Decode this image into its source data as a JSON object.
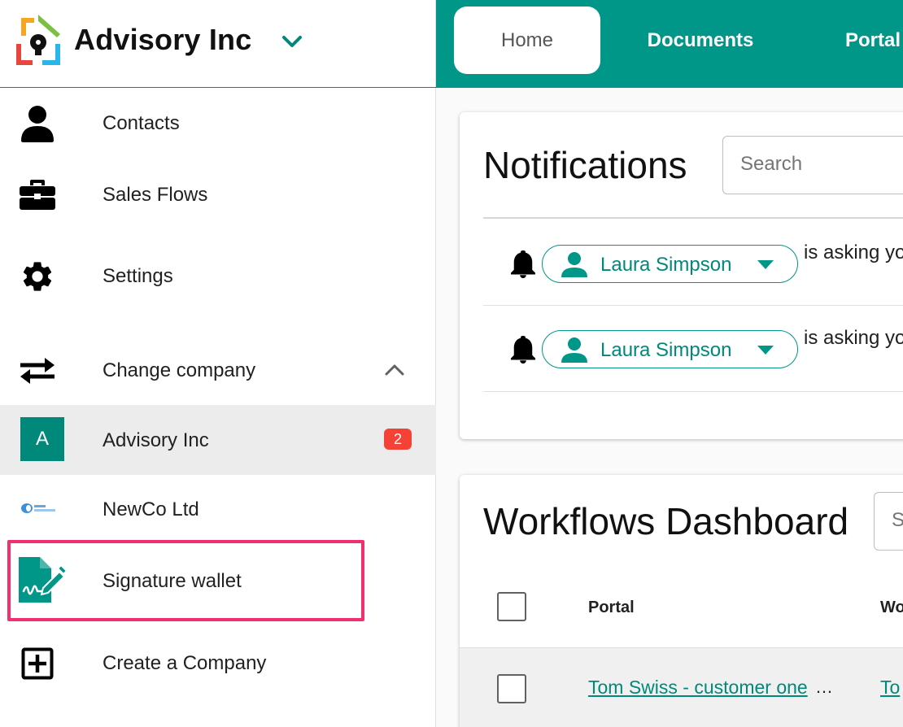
{
  "brand": {
    "name": "Advisory Inc",
    "accent_color": "#009688",
    "chevron_icon": "chevron-down-icon"
  },
  "sidebar": {
    "items": [
      {
        "label": "Contacts",
        "icon": "person-icon"
      },
      {
        "label": "Sales Flows",
        "icon": "briefcase-icon"
      },
      {
        "label": "Settings",
        "icon": "gear-icon"
      },
      {
        "label": "Change company",
        "icon": "swap-arrows-icon"
      }
    ],
    "companies": [
      {
        "initial": "A",
        "label": "Advisory Inc",
        "badge": "2",
        "active": true
      },
      {
        "label": "NewCo Ltd",
        "icon": "newco-logo"
      }
    ],
    "signature_wallet": {
      "label": "Signature wallet",
      "icon": "signature-document-icon"
    },
    "create_company": {
      "label": "Create a Company",
      "icon": "plus-box-icon"
    }
  },
  "tabs": [
    {
      "label": "Home",
      "active": true
    },
    {
      "label": "Documents",
      "active": false
    },
    {
      "label": "Portal",
      "active": false
    }
  ],
  "notifications": {
    "title": "Notifications",
    "search_placeholder": "Search",
    "items": [
      {
        "person": "Laura Simpson",
        "text": "is asking yo"
      },
      {
        "person": "Laura Simpson",
        "text": "is asking yo"
      }
    ]
  },
  "workflows": {
    "title": "Workflows Dashboard",
    "search_placeholder": "S",
    "columns": [
      "Portal",
      "Wo"
    ],
    "rows": [
      {
        "portal": "Tom Swiss - customer one",
        "ellipsis": "…",
        "second": "To"
      }
    ]
  }
}
